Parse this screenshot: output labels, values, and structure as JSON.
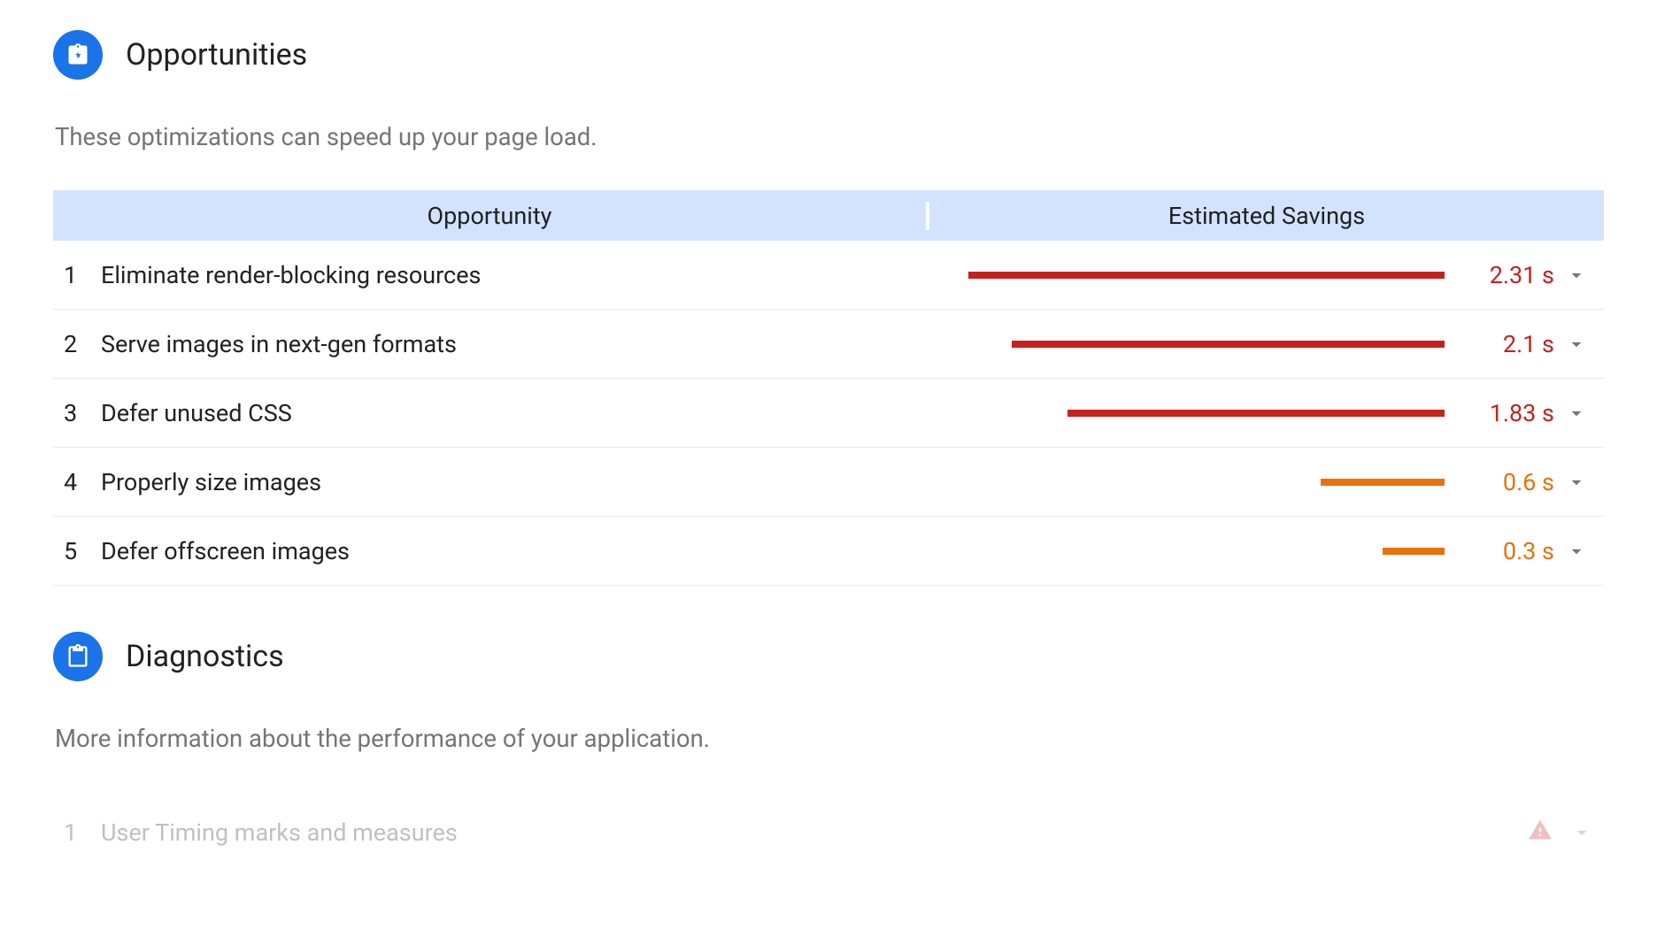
{
  "colors": {
    "accent": "#1a73e8",
    "red": "#c5221f",
    "orange": "#e8710a",
    "header_bg": "#d3e3fd"
  },
  "opportunities": {
    "title": "Opportunities",
    "subtitle": "These optimizations can speed up your page load.",
    "columns": {
      "opportunity": "Opportunity",
      "savings": "Estimated Savings"
    },
    "bar_max_seconds": 2.5,
    "items": [
      {
        "num": "1",
        "label": "Eliminate render-blocking resources",
        "seconds": 2.31,
        "time_text": "2.31 s",
        "color": "#c5221f"
      },
      {
        "num": "2",
        "label": "Serve images in next-gen formats",
        "seconds": 2.1,
        "time_text": "2.1 s",
        "color": "#c5221f"
      },
      {
        "num": "3",
        "label": "Defer unused CSS",
        "seconds": 1.83,
        "time_text": "1.83 s",
        "color": "#c5221f"
      },
      {
        "num": "4",
        "label": "Properly size images",
        "seconds": 0.6,
        "time_text": "0.6 s",
        "color": "#e8710a"
      },
      {
        "num": "5",
        "label": "Defer offscreen images",
        "seconds": 0.3,
        "time_text": "0.3 s",
        "color": "#e8710a"
      }
    ]
  },
  "diagnostics": {
    "title": "Diagnostics",
    "subtitle": "More information about the performance of your application.",
    "items": [
      {
        "num": "1",
        "label": "User Timing marks and measures",
        "status": "warning"
      }
    ]
  }
}
